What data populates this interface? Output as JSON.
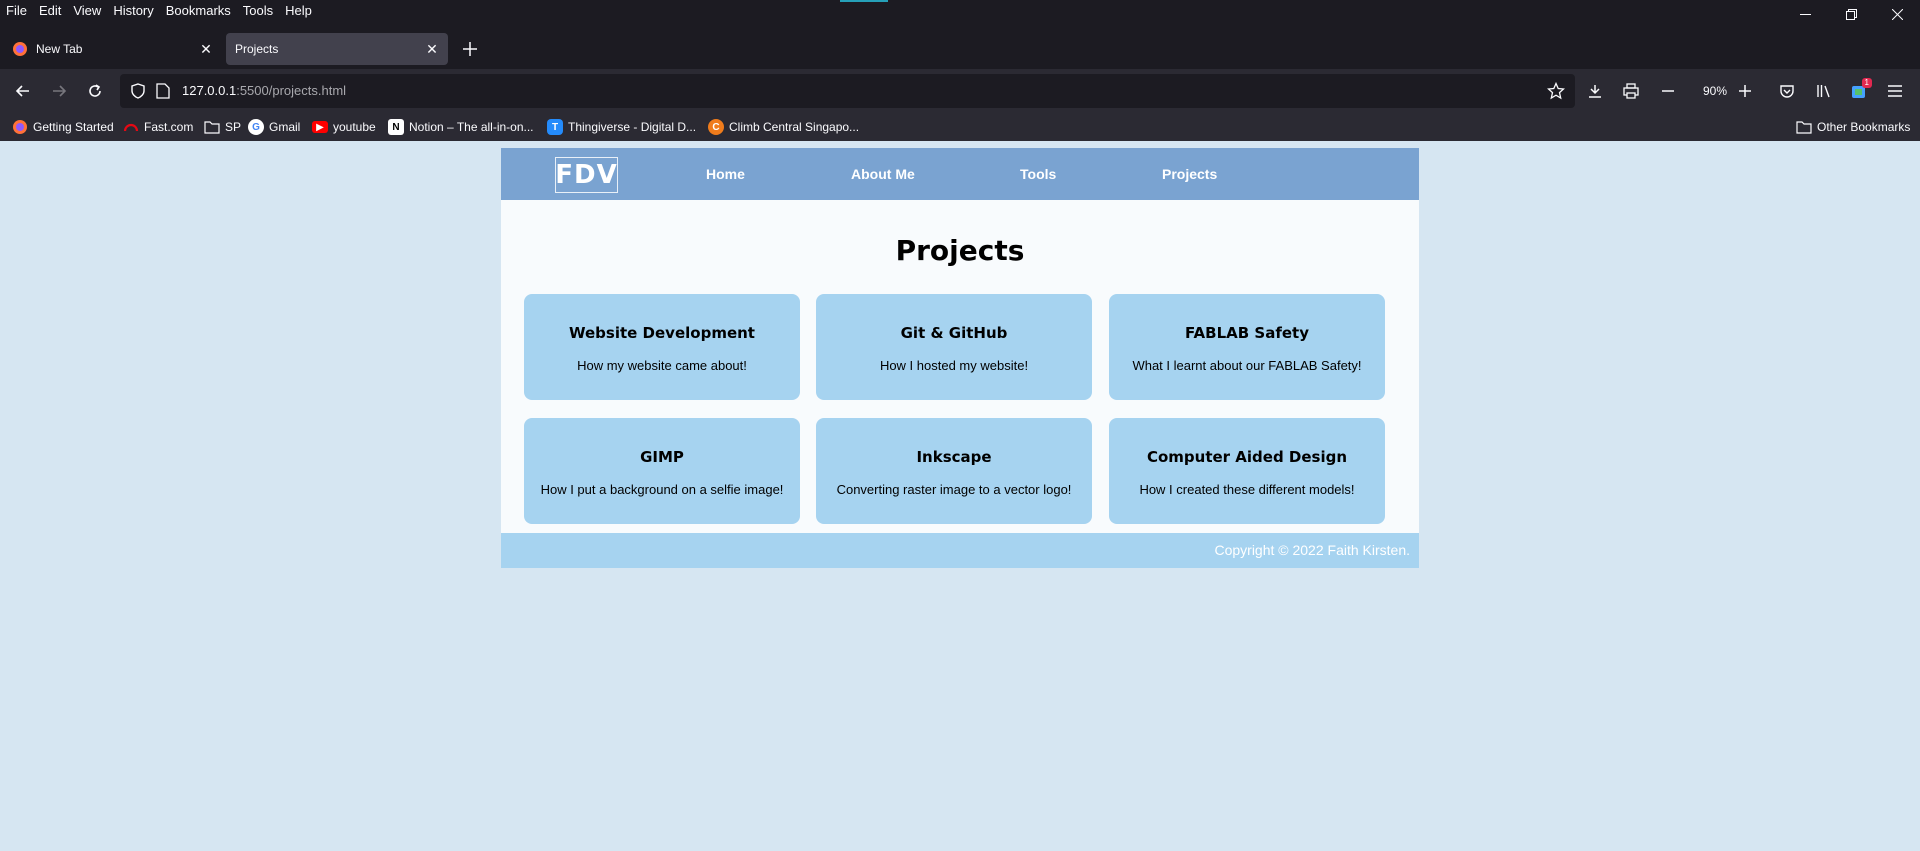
{
  "menubar": {
    "items": [
      "File",
      "Edit",
      "View",
      "History",
      "Bookmarks",
      "Tools",
      "Help"
    ]
  },
  "tabs": [
    {
      "label": "New Tab",
      "active": false
    },
    {
      "label": "Projects",
      "active": true
    }
  ],
  "navbar": {
    "url_host": "127.0.0.1",
    "url_path": ":5500/projects.html",
    "zoom": "90%",
    "extension_badge": "1"
  },
  "bookmarks": {
    "items": [
      {
        "label": "Getting Started",
        "icon": "firefox-icon"
      },
      {
        "label": "Fast.com",
        "icon": "speedometer-icon"
      },
      {
        "label": "SP",
        "icon": "folder-icon"
      },
      {
        "label": "Gmail",
        "icon": "google-icon"
      },
      {
        "label": "youtube",
        "icon": "youtube-icon"
      },
      {
        "label": "Notion – The all-in-on...",
        "icon": "notion-icon"
      },
      {
        "label": "Thingiverse - Digital D...",
        "icon": "thingiverse-icon"
      },
      {
        "label": "Climb Central Singapo...",
        "icon": "climb-icon"
      }
    ],
    "other": "Other Bookmarks"
  },
  "site": {
    "logo": "FDV",
    "nav": [
      "Home",
      "About Me",
      "Tools",
      "Projects"
    ],
    "title": "Projects",
    "cards": [
      {
        "title": "Website Development",
        "desc": "How my website came about!"
      },
      {
        "title": "Git & GitHub",
        "desc": "How I hosted my website!"
      },
      {
        "title": "FABLAB Safety",
        "desc": "What I learnt about our FABLAB Safety!"
      },
      {
        "title": "GIMP",
        "desc": "How I put a background on a selfie image!"
      },
      {
        "title": "Inkscape",
        "desc": "Converting raster image to a vector logo!"
      },
      {
        "title": "Computer Aided Design",
        "desc": "How I created these different models!"
      }
    ],
    "footer": "Copyright © 2022 Faith Kirsten."
  },
  "colors": {
    "header": "#7aa3d1",
    "card": "#a6d3f0",
    "page_bg": "#d6e6f2"
  }
}
